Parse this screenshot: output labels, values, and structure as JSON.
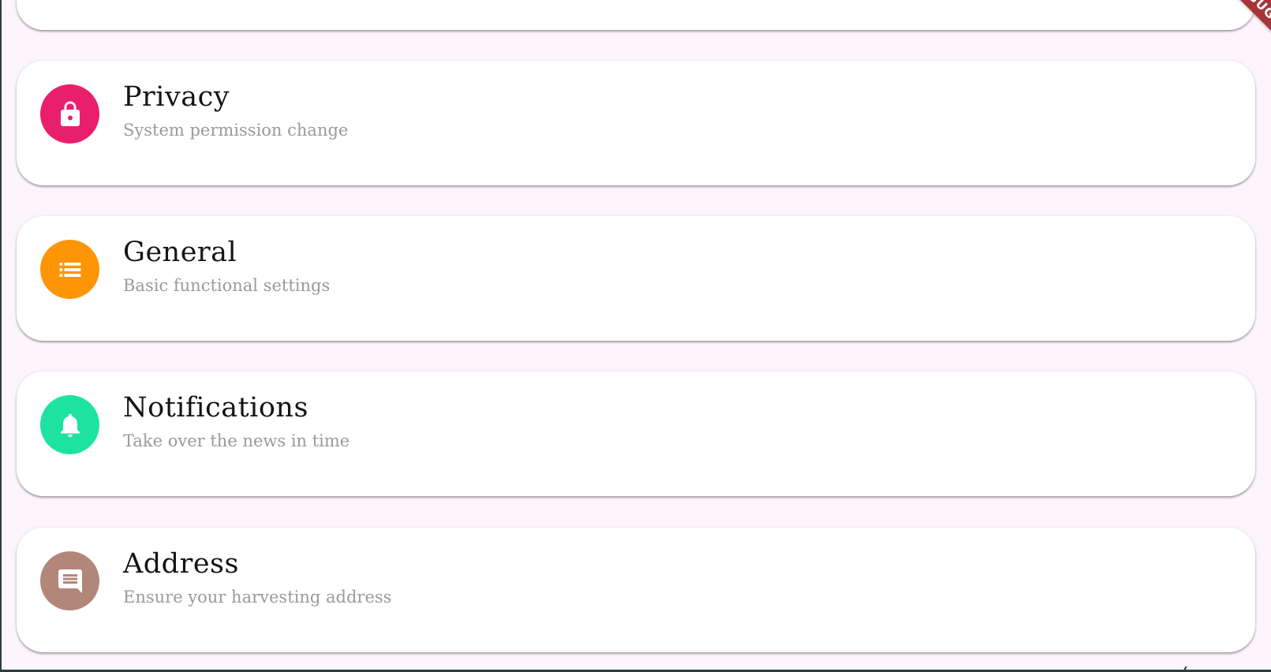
{
  "debug_banner": "DEBUG",
  "settings": [
    {
      "title": "Privacy",
      "subtitle": "System permission change",
      "icon": "lock-icon",
      "color": "#ea1f6b"
    },
    {
      "title": "General",
      "subtitle": "Basic functional settings",
      "icon": "list-icon",
      "color": "#fe9506"
    },
    {
      "title": "Notifications",
      "subtitle": "Take over the news in time",
      "icon": "bell-icon",
      "color": "#1ee3a0"
    },
    {
      "title": "Address",
      "subtitle": "Ensure your harvesting address",
      "icon": "chat-icon",
      "color": "#b2877a"
    }
  ]
}
